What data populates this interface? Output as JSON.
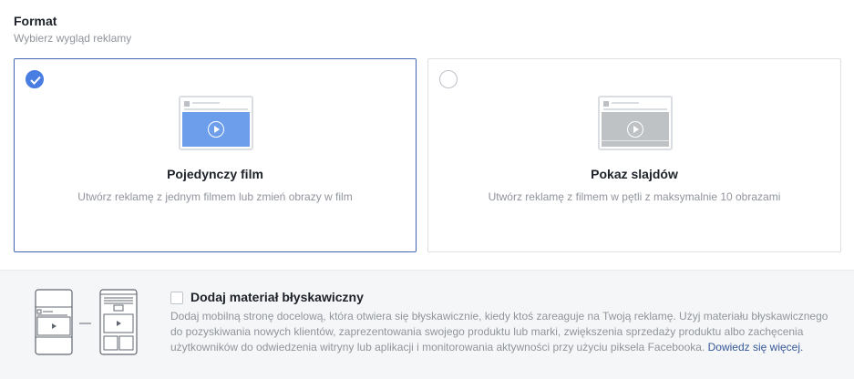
{
  "header": {
    "title": "Format",
    "subtitle": "Wybierz wygląd reklamy"
  },
  "formats": [
    {
      "title": "Pojedynczy film",
      "description": "Utwórz reklamę z jednym filmem lub zmień obrazy w film",
      "selected": true,
      "media_color": "#6d9eeb"
    },
    {
      "title": "Pokaz slajdów",
      "description": "Utwórz reklamę z filmem w pętli z maksymalnie 10 obrazami",
      "selected": false,
      "media_color": "#bfc2c5"
    }
  ],
  "instant_experience": {
    "checked": false,
    "title": "Dodaj materiał błyskawiczny",
    "description": "Dodaj mobilną stronę docelową, która otwiera się błyskawicznie, kiedy ktoś zareaguje na Twoją reklamę. Użyj materiału błyskawicznego do pozyskiwania nowych klientów, zaprezentowania swojego produktu lub marki, zwiększenia sprzedaży produktu albo zachęcenia użytkowników do odwiedzenia witryny lub aplikacji i monitorowania aktywności przy użyciu piksela Facebooka.",
    "link_label": "Dowiedz się więcej."
  },
  "colors": {
    "accent": "#4267b2",
    "check_blue": "#4a7de2",
    "link": "#365899"
  }
}
